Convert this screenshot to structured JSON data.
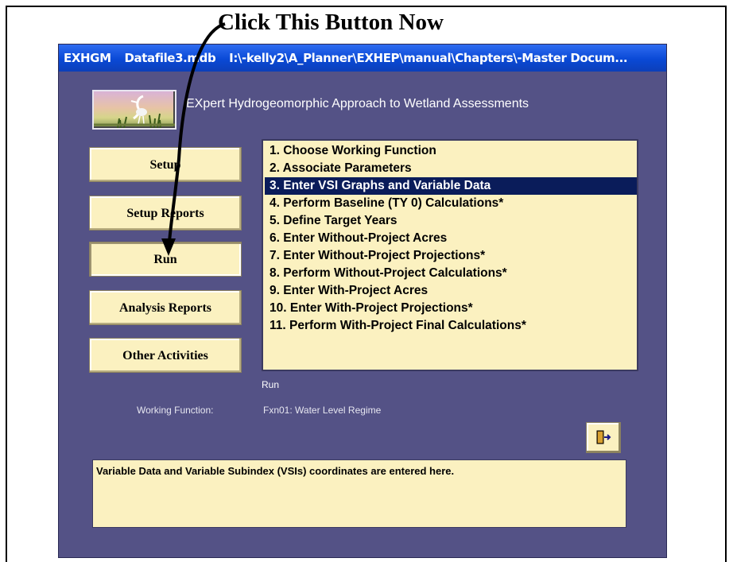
{
  "annotation": {
    "text": "Click This Button Now"
  },
  "window": {
    "title_parts": [
      "EXHGM",
      "Datafile3.mdb",
      "I:\\-kelly2\\A_Planner\\EXHEP\\manual\\Chapters\\-Master Docum..."
    ]
  },
  "app": {
    "title": "EXpert Hydrogeomorphic Approach to Wetland Assessments"
  },
  "nav": {
    "setup": "Setup",
    "setup_reports": "Setup Reports",
    "run": "Run",
    "analysis_reports": "Analysis Reports",
    "other_activities": "Other Activities"
  },
  "tasks": [
    "1.  Choose Working Function",
    "2.  Associate Parameters",
    "3.  Enter VSI Graphs and Variable Data",
    "4.  Perform Baseline (TY 0) Calculations*",
    "5.  Define Target Years",
    "6.  Enter Without-Project Acres",
    "7.  Enter Without-Project Projections*",
    "8.  Perform Without-Project Calculations*",
    "9.  Enter With-Project Acres",
    "10. Enter With-Project Projections*",
    "11. Perform With-Project Final Calculations*"
  ],
  "selected_task_index": 2,
  "status": "Run",
  "working_function": {
    "label": "Working Function:",
    "value": "Fxn01: Water Level Regime"
  },
  "exit_icon": "exit-door-icon",
  "description": "Variable Data and Variable Subindex (VSIs) coordinates are entered here.",
  "colors": {
    "window_bg": "#545286",
    "button_bg": "#fbf1c0",
    "selection": "#0a1c5a",
    "titlebar": "#0a49d6"
  }
}
